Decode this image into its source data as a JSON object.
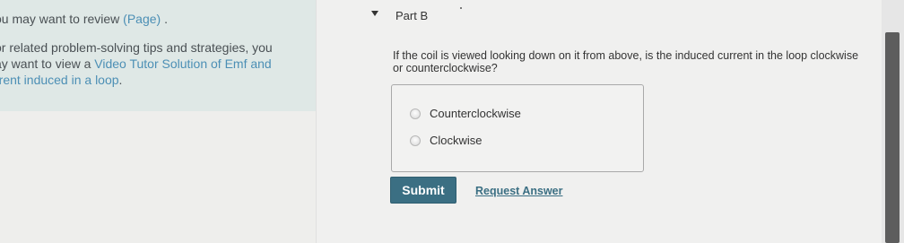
{
  "left": {
    "review_prefix": "ou may want to review ",
    "review_link": "(Page)",
    "review_suffix": " .",
    "tips_line1": "or related problem-solving tips and strategies, you",
    "tips_line2_prefix": "ay want to view a ",
    "tips_line2_link": "Video Tutor Solution of Emf and",
    "tips_line3_link": "rrent induced in a loop",
    "tips_line3_suffix": "."
  },
  "part": {
    "title": "Part B",
    "question": "If the coil is viewed looking down on it from above, is the induced current in the loop clockwise or counterclockwise?",
    "options": [
      {
        "label": "Counterclockwise"
      },
      {
        "label": "Clockwise"
      }
    ],
    "submit_label": "Submit",
    "request_label": "Request Answer"
  },
  "colors": {
    "accent": "#3b6f83",
    "link": "#4c8fb5",
    "tip_background": "#dfe8e6"
  }
}
